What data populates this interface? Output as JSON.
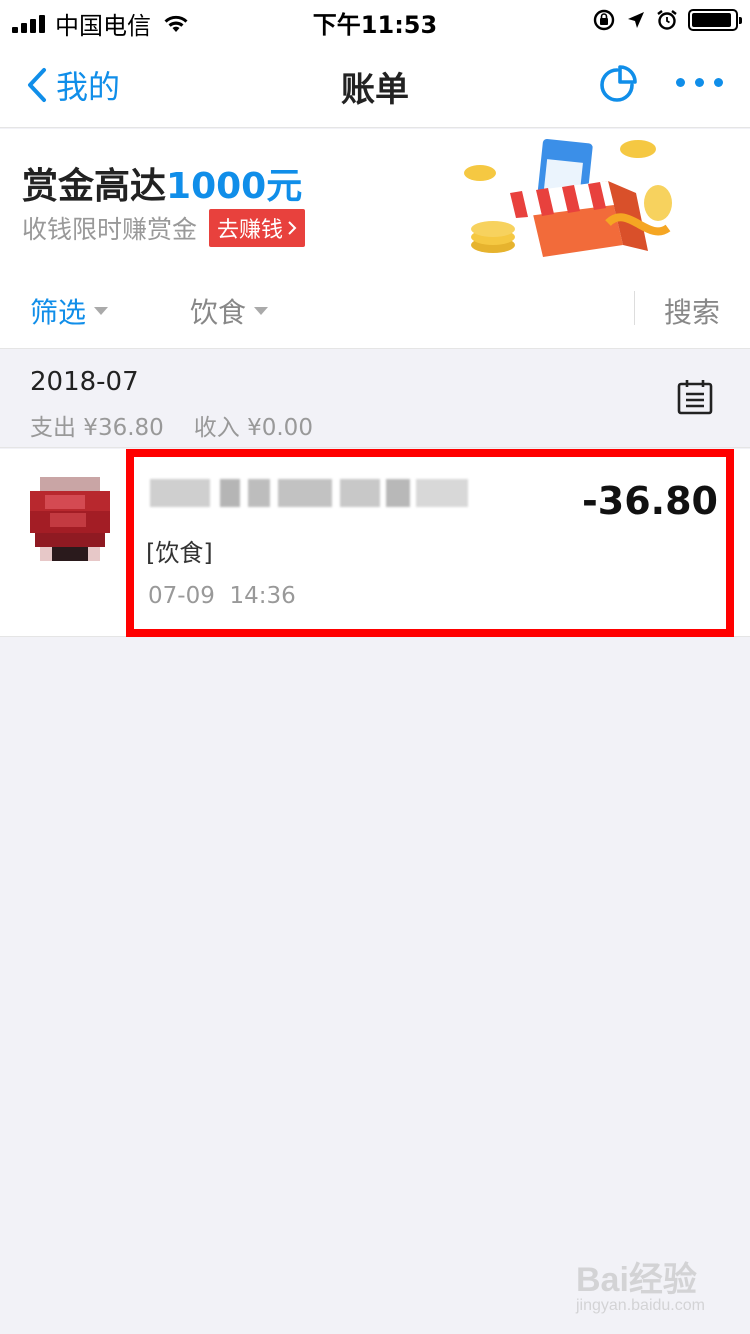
{
  "status_bar": {
    "carrier": "中国电信",
    "time": "下午11:53"
  },
  "nav": {
    "back_label": "我的",
    "title": "账单",
    "accent_color": "#108ee9"
  },
  "banner": {
    "title_prefix": "赏金高达",
    "title_amount": "1000元",
    "subtitle": "收钱限时赚赏金",
    "button_label": "去赚钱"
  },
  "filter": {
    "screen_label": "筛选",
    "category_label": "饮食",
    "search_label": "搜索"
  },
  "month": {
    "label": "2018-07",
    "expense": "支出 ¥36.80",
    "income": "收入 ¥0.00"
  },
  "bills": [
    {
      "amount": "-36.80",
      "category": "[饮食]",
      "time": "07-09  14:36"
    }
  ],
  "watermark": {
    "logo": "Bai经验",
    "url": "jingyan.baidu.com"
  }
}
